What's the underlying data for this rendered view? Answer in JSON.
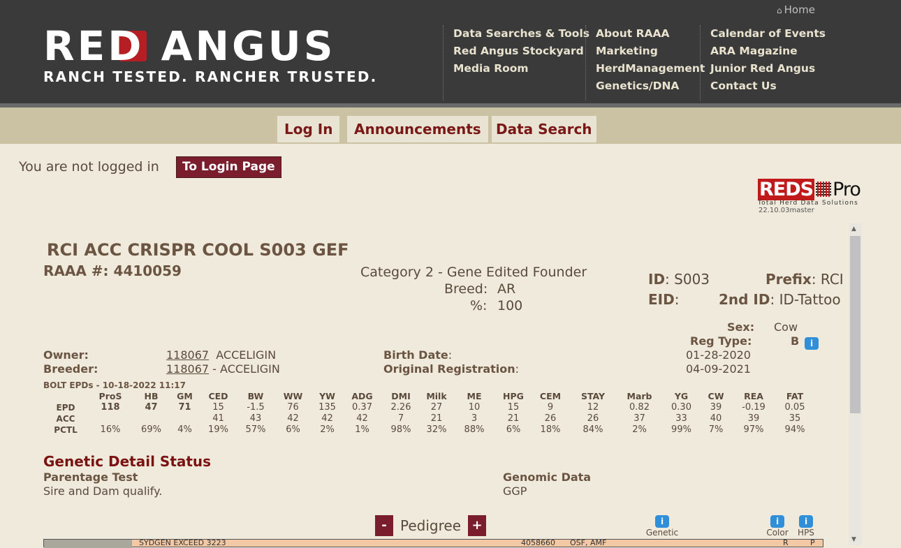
{
  "header": {
    "logo_text": "RED ANGUS",
    "tagline": "RANCH TESTED. RANCHER TRUSTED.",
    "home_label": "Home",
    "nav_col1": [
      "Data Searches & Tools",
      "Red Angus Stockyard",
      "Media Room"
    ],
    "nav_col2": [
      "About RAAA",
      "Marketing",
      "HerdManagement",
      "Genetics/DNA"
    ],
    "nav_col3": [
      "Calendar of Events",
      "ARA Magazine",
      "Junior Red Angus",
      "Contact Us"
    ]
  },
  "tabs": [
    "Log In",
    "Announcements",
    "Data Search"
  ],
  "login": {
    "status": "You are not logged in",
    "button": "To Login Page"
  },
  "reds": {
    "logo_red": "REDS",
    "logo_pro": "Pro",
    "subtitle": "Total Herd Data Solutions",
    "version": "22.10.03master"
  },
  "animal": {
    "name": "RCI ACC CRISPR COOL S003 GEF",
    "raaa_label": "RAAA #:",
    "raaa_no": "4410059",
    "category": "Category 2 - Gene Edited Founder",
    "breed_label": "Breed:",
    "breed": "AR",
    "pct_label": "%:",
    "pct": "100",
    "id_label": "ID",
    "id": "S003",
    "prefix_label": "Prefix",
    "prefix": "RCI",
    "eid_label": "EID",
    "eid": "",
    "id2_label": "2nd ID",
    "id2": "ID-Tattoo",
    "sex_label": "Sex:",
    "sex": "Cow",
    "regtype_label": "Reg Type:",
    "regtype": "B",
    "owner_label": "Owner:",
    "owner_no": "118067",
    "owner_name": "ACCELIGIN",
    "breeder_label": "Breeder:",
    "breeder_no": "118067",
    "breeder_name": "- ACCELIGIN",
    "birth_label": "Birth Date",
    "birth_date": "01-28-2020",
    "origreg_label": "Original Registration",
    "origreg_date": "04-09-2021"
  },
  "epd": {
    "title": "BOLT EPDs - 10-18-2022 11:17",
    "headers": [
      "",
      "ProS",
      "HB",
      "GM",
      "CED",
      "BW",
      "WW",
      "YW",
      "ADG",
      "DMI",
      "Milk",
      "ME",
      "HPG",
      "CEM",
      "STAY",
      "Marb",
      "YG",
      "CW",
      "REA",
      "FAT"
    ],
    "rows": [
      [
        "EPD",
        "118",
        "47",
        "71",
        "15",
        "-1.5",
        "76",
        "135",
        "0.37",
        "2.26",
        "27",
        "10",
        "15",
        "9",
        "12",
        "0.82",
        "0.30",
        "39",
        "-0.19",
        "0.05"
      ],
      [
        "ACC",
        "",
        "",
        "",
        "41",
        "43",
        "42",
        "42",
        "42",
        "7",
        "21",
        "3",
        "21",
        "26",
        "26",
        "37",
        "33",
        "40",
        "39",
        "35"
      ],
      [
        "PCTL",
        "16%",
        "69%",
        "4%",
        "19%",
        "57%",
        "6%",
        "2%",
        "1%",
        "98%",
        "32%",
        "88%",
        "6%",
        "18%",
        "84%",
        "2%",
        "99%",
        "7%",
        "97%",
        "94%"
      ]
    ]
  },
  "genetic": {
    "title": "Genetic Detail Status",
    "parentage_label": "Parentage Test",
    "parentage_value": "Sire and Dam qualify.",
    "genomic_label": "Genomic Data",
    "genomic_value": "GGP"
  },
  "pedigree": {
    "minus": "-",
    "label": "Pedigree",
    "plus": "+",
    "genetic_label": "Genetic",
    "color_label": "Color",
    "hps_label": "HPS",
    "row_name": "SYDGEN EXCEED 3223",
    "row_reg": "4058660",
    "row_codes": "OSF, AMF",
    "row_color": "R",
    "row_hps": "P"
  }
}
